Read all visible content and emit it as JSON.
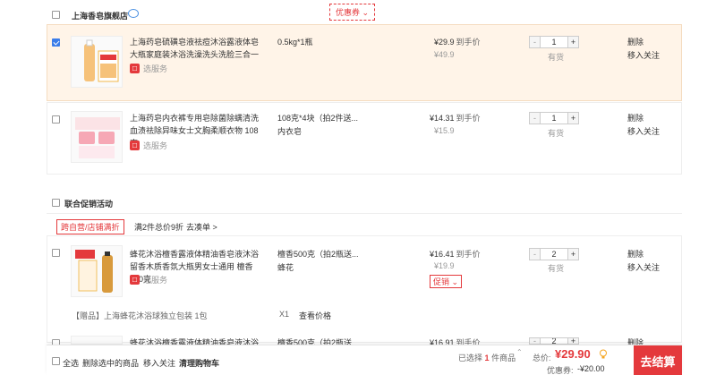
{
  "shop": {
    "name": "上海香皂旗舰店",
    "coupon_label": "优惠券",
    "coupon_chevron": "⌄"
  },
  "items": [
    {
      "title": "上海药皂硫磺皂液祛痘沐浴露液体皂大瓶家庭装沐浴洗澡洗头洗脸三合一",
      "service": "选服务",
      "spec": "0.5kg*1瓶",
      "spec2": "",
      "price": "¥29.9",
      "price_suffix": "到手价",
      "original": "¥49.9",
      "qty": "1",
      "stock": "有货",
      "delete": "删除",
      "follow": "移入关注"
    },
    {
      "title": "上海药皂内衣裤专用皂除菌除螨清洗血渍祛除异味女士文胸柔顺衣物 108克",
      "service": "选服务",
      "spec": "108克*4块（拍2件送...",
      "spec2": "内衣皂",
      "price": "¥14.31",
      "price_suffix": "到手价",
      "original": "¥15.9",
      "qty": "1",
      "stock": "有货",
      "delete": "删除",
      "follow": "移入关注"
    }
  ],
  "promo_section": {
    "title": "联合促销活动",
    "tag": "跨自营/店铺满折",
    "desc": "满2件总价9折",
    "link": "去凑单 >",
    "items": [
      {
        "title": "蜂花沐浴檀香露液体精油香皂液沐浴留香木质香氛大瓶男女士通用 檀香500克",
        "service": "选服务",
        "spec": "檀香500克（拍2瓶送...",
        "spec2": "蜂花",
        "price": "¥16.41",
        "price_suffix": "到手价",
        "original": "¥19.9",
        "promo": "促销",
        "qty": "2",
        "stock": "有货",
        "delete": "删除",
        "follow": "移入关注"
      },
      {
        "title": "蜂花沐浴檀香露液体精油香皂液沐浴留",
        "spec": "檀香500克（拍2瓶送...",
        "price": "¥16.91",
        "price_suffix": "到手价",
        "qty": "2",
        "delete": "删除"
      }
    ],
    "gift": {
      "label": "【赠品】上海蜂花沐浴球独立包装 1包",
      "qty": "X1",
      "link": "查看价格"
    }
  },
  "bottom": {
    "select_all": "全选",
    "delete_selected": "删除选中的商品",
    "move_follow": "移入关注",
    "clear_cart": "清理购物车",
    "selected_prefix": "已选择",
    "selected_count": "1",
    "selected_suffix": "件商品",
    "total_label": "总价:",
    "total": "¥29.90",
    "discount_label": "优惠券:",
    "discount": "-¥20.00",
    "checkout": "去结算"
  },
  "colors": {
    "accent": "#e4393c",
    "checkbox": "#3b7de9",
    "selected_row": "#fff4e8"
  }
}
